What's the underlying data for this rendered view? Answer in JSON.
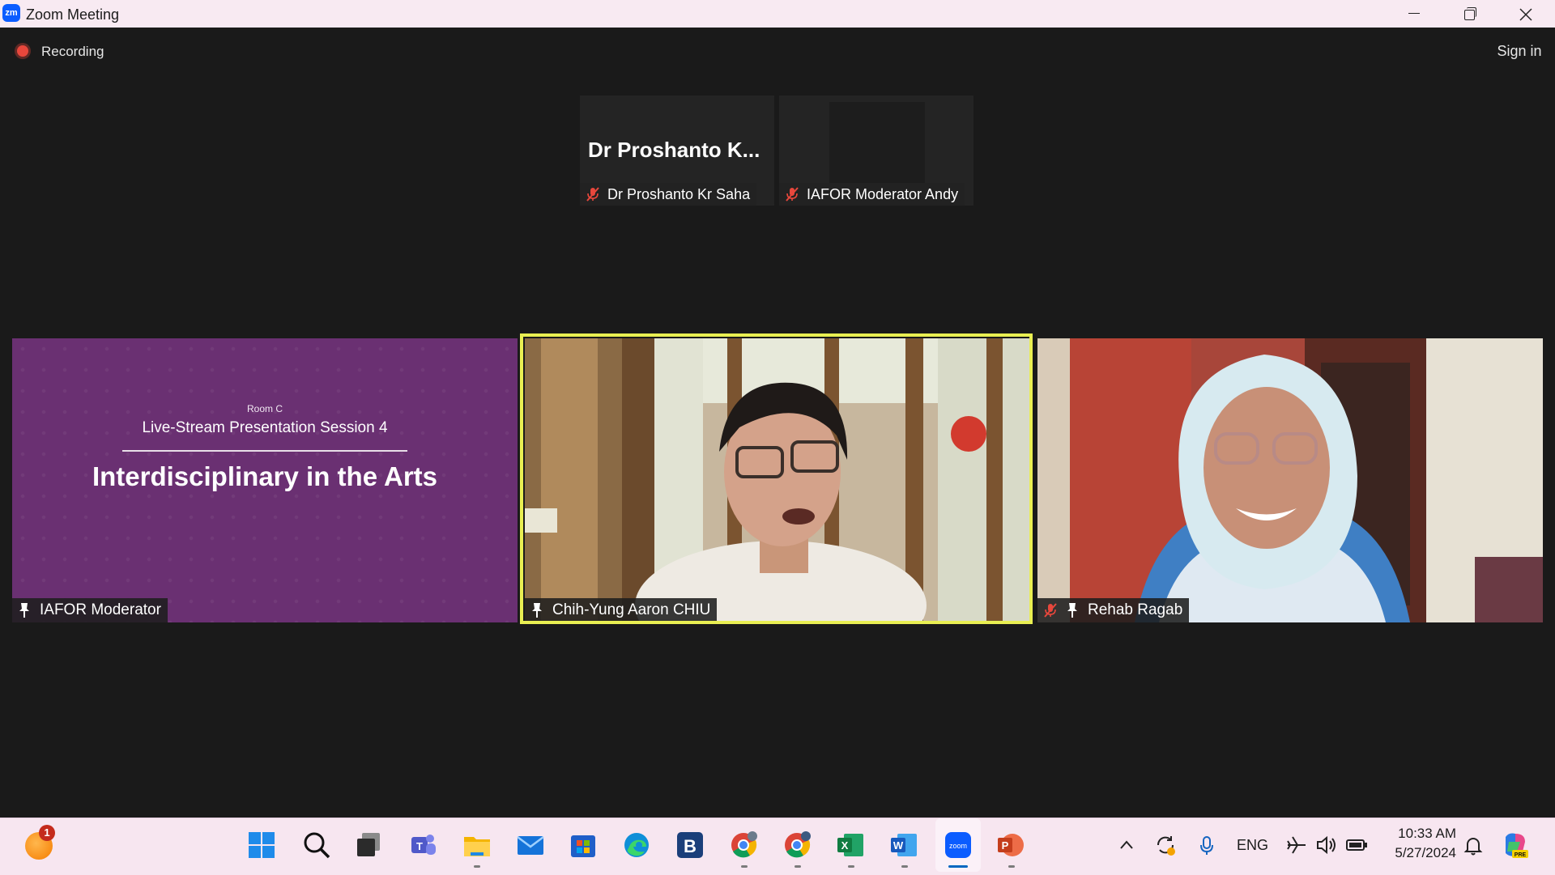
{
  "window": {
    "title": "Zoom Meeting",
    "app_logo": "zm"
  },
  "toolbar": {
    "recording_label": "Recording",
    "signin_label": "Sign in"
  },
  "thumbnails": [
    {
      "big_name": "Dr Proshanto K...",
      "label": "Dr Proshanto Kr Saha",
      "muted": true
    },
    {
      "label": "IAFOR Moderator Andy",
      "muted": true
    }
  ],
  "tiles": [
    {
      "label": "IAFOR Moderator",
      "slide": {
        "room": "Room C",
        "session": "Live-Stream Presentation Session 4",
        "title": "Interdisciplinary in the Arts"
      }
    },
    {
      "label": "Chih-Yung Aaron CHIU",
      "active_speaker": true
    },
    {
      "label": "Rehab Ragab",
      "muted": true
    }
  ],
  "taskbar": {
    "widget_badge": "1",
    "apps": [
      "start-icon",
      "search-icon",
      "task-view-icon",
      "teams-icon",
      "file-explorer-icon",
      "mail-icon",
      "store-icon",
      "edge-icon",
      "b-app-icon",
      "chrome-icon",
      "chrome-icon",
      "excel-icon",
      "word-icon",
      "zoom-icon",
      "powerpoint-icon"
    ],
    "language": "ENG",
    "time": "10:33 AM",
    "date": "5/27/2024"
  },
  "colors": {
    "active_border": "#e9ef52",
    "slide_bg": "#6a3072",
    "record_red": "#e8473c",
    "taskbar_bg": "#f7e6f0"
  }
}
